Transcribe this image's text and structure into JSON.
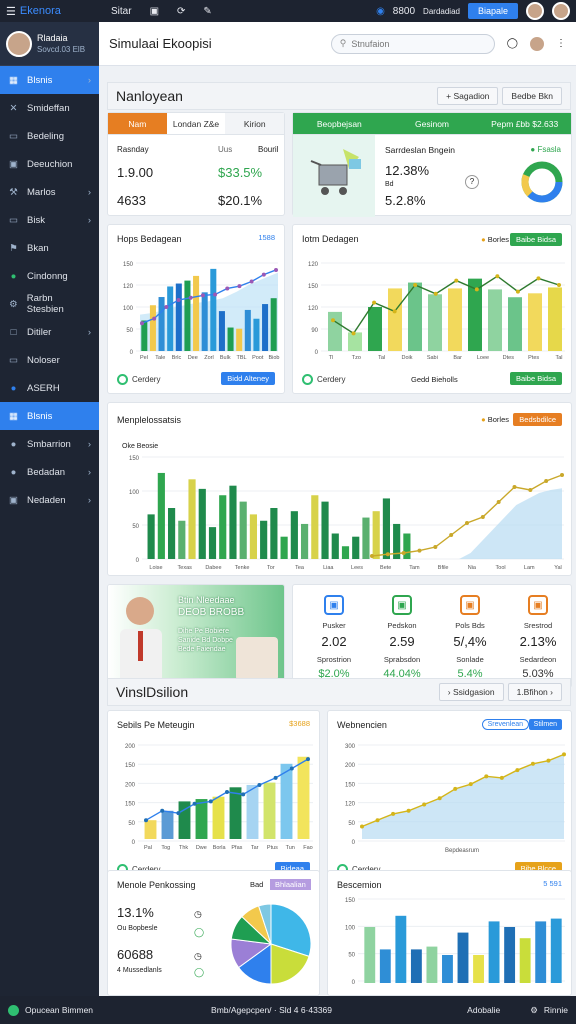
{
  "topbar": {
    "brand": "Ekenora",
    "tabs": [
      "Sitar"
    ],
    "count": "8800",
    "user_label": "Dardadiad",
    "button": "Biapale"
  },
  "sidebar": {
    "profile": {
      "name": "Rladaia",
      "sub": "Sovcd.03 ElB"
    },
    "items": [
      {
        "label": "Blsnis",
        "icon": "grid",
        "active": true,
        "chev": true
      },
      {
        "label": "Smideffan",
        "icon": "x",
        "chev": false
      },
      {
        "label": "Bedeling",
        "icon": "doc",
        "chev": false
      },
      {
        "label": "Deeuchion",
        "icon": "bag",
        "chev": false
      },
      {
        "label": "Marlos",
        "icon": "tools",
        "chev": true
      },
      {
        "label": "Bisk",
        "icon": "doc",
        "chev": true
      },
      {
        "label": "Bkan",
        "icon": "flag",
        "chev": false
      },
      {
        "label": "Cindonng",
        "icon": "circle",
        "green": true,
        "chev": false
      },
      {
        "label": "Rarbn Stesbien",
        "icon": "gear",
        "chev": false
      },
      {
        "label": "Ditiler",
        "icon": "screen",
        "chev": true
      },
      {
        "label": "Noloser",
        "icon": "doc",
        "chev": false
      },
      {
        "label": "ASERH",
        "icon": "circle",
        "blue": true,
        "chev": false
      },
      {
        "label": "Blsnis",
        "icon": "grid",
        "active": true,
        "chev": false
      },
      {
        "label": "Smbarrion",
        "icon": "circle",
        "chev": true
      },
      {
        "label": "Bedadan",
        "icon": "circle",
        "chev": true
      },
      {
        "label": "Nedaden",
        "icon": "bag",
        "chev": true
      }
    ]
  },
  "header": {
    "title": "Simulaai Ekoopisi",
    "search_placeholder": "Stnufaion"
  },
  "section1": {
    "title": "Nanloyean",
    "btn1": "Sagadion",
    "btn2": "Bedbe Bkn"
  },
  "card_a": {
    "tabs": [
      "Nam",
      "Londan Z&e",
      "Kirion"
    ],
    "row_labels": [
      "Rasnday",
      "Uus",
      "Bouril"
    ],
    "rows": [
      {
        "left": "1.9.00",
        "right": "$33.5%"
      },
      {
        "left": "4633",
        "right": "$20.1%"
      }
    ]
  },
  "card_b": {
    "tabs": [
      "Beopbejsan",
      "Gesinom",
      "Pepm £bb $2.633"
    ],
    "title": "Sarrdeslan Bngein",
    "tag": "Fsasla",
    "v1": "12.38%",
    "v2label": "Bd",
    "v3": "5.2.8%"
  },
  "chart1": {
    "title": "Hops Bedagean",
    "tag": "1588",
    "footer": "Cerdery",
    "button": "Bidd Alteney",
    "yticks": [
      "150",
      "120",
      "100",
      "50",
      "0"
    ],
    "xticks": [
      "Pel",
      "Tale",
      "Brlc",
      "Dee",
      "Zorl",
      "Bulk",
      "TBL",
      "Poot",
      "Biob"
    ]
  },
  "chart2": {
    "title": "Iotm Dedagen",
    "legend": "Borles",
    "button": "Baibe Bidsa",
    "footer": "Cerdery",
    "footer_mid": "Gedd Bieholls",
    "yticks": [
      "120",
      "150",
      "120",
      "90",
      "0"
    ],
    "xticks": [
      "Tl",
      "Tzo",
      "Tal",
      "Doik",
      "Sabi",
      "Bar",
      "Loee",
      "Dtes",
      "Ptes",
      "Tal"
    ]
  },
  "chart3": {
    "title": "Menplelossatsis",
    "legend": "Borles",
    "button": "Bedsbdilce",
    "ylabel": "Oke Beosie",
    "yticks": [
      "150",
      "100",
      "50",
      "0"
    ],
    "xticks": [
      "Loise",
      "Texas",
      "Dabee",
      "Tenke",
      "Tor",
      "Tea",
      "Liaa",
      "Lees",
      "Bete",
      "Tam",
      "Bfile",
      "Nia",
      "Tool",
      "Lam",
      "Yal"
    ]
  },
  "promo": {
    "line1": "Btin Nleedaae",
    "line2": "DEOB BROBB",
    "line3": "Dihe Pe Bobiere",
    "line4": "Sanide Bd Dobpe",
    "line5": "Bede Faiendae"
  },
  "stats": [
    {
      "label": "Pusker",
      "value": "2.02",
      "label2": "Sprostrion",
      "value2": "$2.0%",
      "color": "#2f80ed",
      "v2color": "#2fa64f"
    },
    {
      "label": "Pedskon",
      "value": "2.59",
      "label2": "Sprabsdon",
      "value2": "44.04%",
      "color": "#2fa64f",
      "v2color": "#2fa64f"
    },
    {
      "label": "Pols Bds",
      "value": "5/,4%",
      "label2": "Sonlade",
      "value2": "5.4%",
      "color": "#e67e22",
      "v2color": "#2fa64f"
    },
    {
      "label": "Srestrod",
      "value": "2.13%",
      "label2": "Sedardeon",
      "value2": "5.03%",
      "color": "#e67e22",
      "v2color": "#333"
    }
  ],
  "section2": {
    "title": "VinslDsilion",
    "btn1": "Ssidgasion",
    "btn2": "1.Bfihon"
  },
  "chart4": {
    "title": "Sebils Pe Meteugin",
    "tag": "$3688",
    "footer": "Cerdery",
    "button": "Bideaa",
    "yticks": [
      "200",
      "150",
      "200",
      "150",
      "50",
      "0"
    ],
    "xticks": [
      "Pal",
      "Tog",
      "Thk",
      "Dwe",
      "Borla",
      "Pfas",
      "Tar",
      "Ptus",
      "Tun",
      "Fao"
    ]
  },
  "chart5": {
    "title": "Webnencien",
    "chip1": "Srevenlean",
    "chip2": "Stilmen",
    "footer": "Cerdery",
    "button": "Bibe Blcce",
    "yticks": [
      "300",
      "200",
      "150",
      "120",
      "50",
      "0"
    ],
    "xlabel": "Bepdeasrum"
  },
  "panel_pie": {
    "title": "Menole Penkossing",
    "tag1": "Bad",
    "tag2": "Bhlaalian",
    "v1": "13.1%",
    "v1s": "Ou Bopbesle",
    "v2": "60688",
    "v2s": "4 Mussedlanls"
  },
  "chart6": {
    "title": "Bescemion",
    "tag": "5 591",
    "yticks": [
      "150",
      "100",
      "50",
      "0"
    ]
  },
  "bottom": {
    "left": "Opucean Bimmen",
    "mid": "Bmb/Agepcpen/ · Sld 4 6·43369",
    "r1": "Adobalie",
    "r2": "Rinnie"
  },
  "chart_data": [
    {
      "type": "bar",
      "title": "Hops Bedagean",
      "series": [
        {
          "values": [
            52,
            78,
            92,
            110,
            115,
            120,
            128,
            100,
            140,
            68,
            40,
            38,
            70,
            55,
            80,
            90
          ]
        },
        {
          "values": [
            95,
            100,
            110,
            118,
            125,
            130,
            138,
            155,
            175,
            190,
            205
          ]
        }
      ],
      "ylim": [
        0,
        150
      ]
    },
    {
      "type": "bar",
      "title": "Iotm Dedagen",
      "series": [
        {
          "values": [
            80,
            38,
            90,
            128,
            140,
            116,
            128,
            148,
            126,
            110,
            118,
            130
          ]
        }
      ],
      "ylim": [
        0,
        180
      ]
    },
    {
      "type": "bar",
      "title": "Menplelossatsis",
      "series": [
        {
          "values": [
            70,
            135,
            80,
            60,
            125,
            110,
            50,
            100,
            115,
            90,
            70,
            60,
            80,
            35,
            75,
            55,
            100,
            90,
            40,
            20,
            35,
            65,
            75,
            95,
            55,
            40
          ]
        }
      ],
      "ylim": [
        0,
        160
      ]
    },
    {
      "type": "bar",
      "title": "Sebils Pe Meteugin",
      "series": [
        {
          "values": [
            40,
            60,
            80,
            85,
            90,
            110,
            115,
            120,
            160,
            175
          ]
        }
      ],
      "ylim": [
        0,
        200
      ]
    },
    {
      "type": "area",
      "title": "Webnencien",
      "series": [
        {
          "values": [
            40,
            60,
            80,
            90,
            110,
            130,
            160,
            175,
            200,
            195,
            220,
            240,
            250,
            270
          ]
        }
      ],
      "ylim": [
        0,
        300
      ]
    },
    {
      "type": "pie",
      "title": "Menole Penkossing",
      "values": [
        30,
        20,
        15,
        12,
        10,
        8,
        5
      ]
    },
    {
      "type": "bar",
      "title": "Bescemion",
      "series": [
        {
          "values": [
            100,
            60,
            120,
            60,
            65,
            50,
            90,
            50,
            110,
            100,
            80,
            110,
            115
          ]
        }
      ],
      "ylim": [
        0,
        150
      ]
    }
  ]
}
